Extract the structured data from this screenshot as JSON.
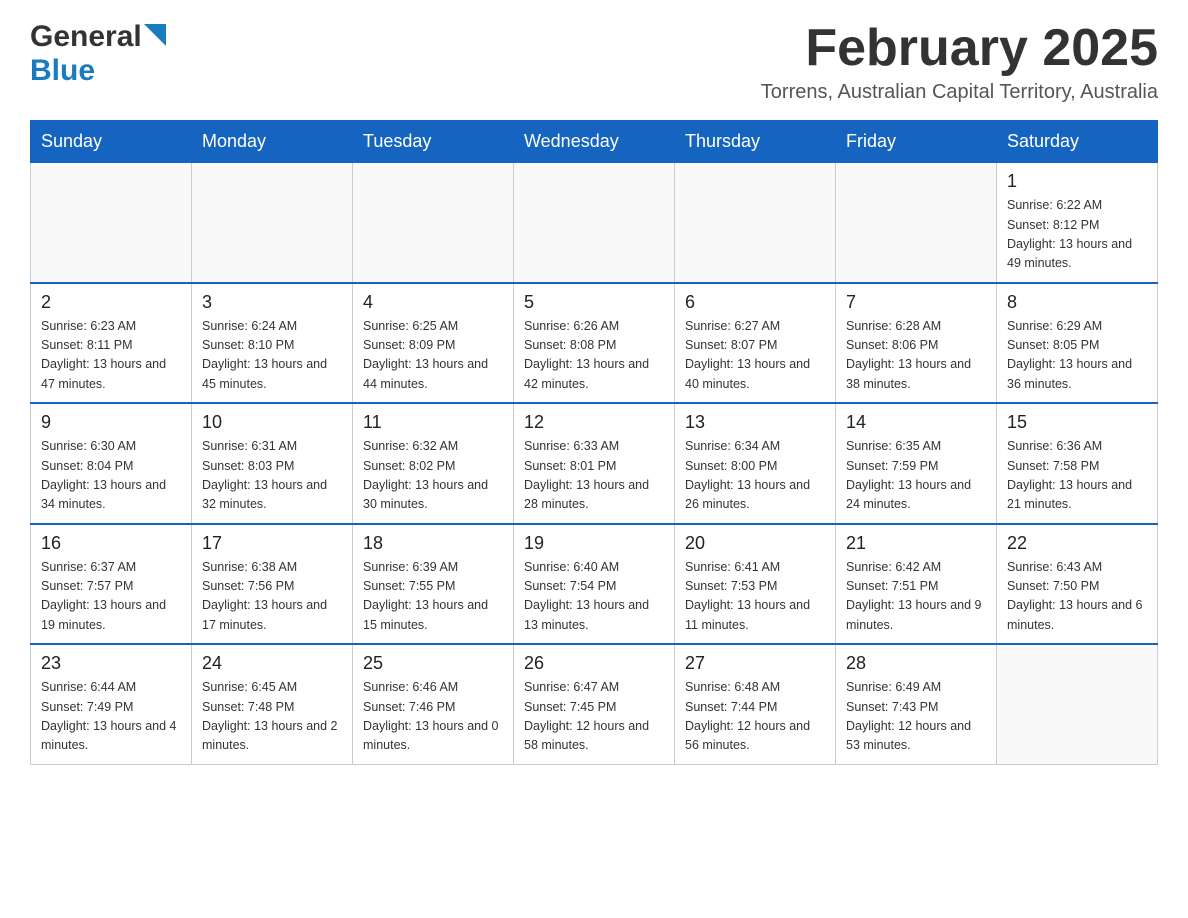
{
  "header": {
    "logo_general": "General",
    "logo_blue": "Blue",
    "title": "February 2025",
    "location": "Torrens, Australian Capital Territory, Australia"
  },
  "days_of_week": [
    "Sunday",
    "Monday",
    "Tuesday",
    "Wednesday",
    "Thursday",
    "Friday",
    "Saturday"
  ],
  "weeks": [
    [
      {
        "day": "",
        "sunrise": "",
        "sunset": "",
        "daylight": "",
        "empty": true
      },
      {
        "day": "",
        "sunrise": "",
        "sunset": "",
        "daylight": "",
        "empty": true
      },
      {
        "day": "",
        "sunrise": "",
        "sunset": "",
        "daylight": "",
        "empty": true
      },
      {
        "day": "",
        "sunrise": "",
        "sunset": "",
        "daylight": "",
        "empty": true
      },
      {
        "day": "",
        "sunrise": "",
        "sunset": "",
        "daylight": "",
        "empty": true
      },
      {
        "day": "",
        "sunrise": "",
        "sunset": "",
        "daylight": "",
        "empty": true
      },
      {
        "day": "1",
        "sunrise": "Sunrise: 6:22 AM",
        "sunset": "Sunset: 8:12 PM",
        "daylight": "Daylight: 13 hours and 49 minutes.",
        "empty": false
      }
    ],
    [
      {
        "day": "2",
        "sunrise": "Sunrise: 6:23 AM",
        "sunset": "Sunset: 8:11 PM",
        "daylight": "Daylight: 13 hours and 47 minutes.",
        "empty": false
      },
      {
        "day": "3",
        "sunrise": "Sunrise: 6:24 AM",
        "sunset": "Sunset: 8:10 PM",
        "daylight": "Daylight: 13 hours and 45 minutes.",
        "empty": false
      },
      {
        "day": "4",
        "sunrise": "Sunrise: 6:25 AM",
        "sunset": "Sunset: 8:09 PM",
        "daylight": "Daylight: 13 hours and 44 minutes.",
        "empty": false
      },
      {
        "day": "5",
        "sunrise": "Sunrise: 6:26 AM",
        "sunset": "Sunset: 8:08 PM",
        "daylight": "Daylight: 13 hours and 42 minutes.",
        "empty": false
      },
      {
        "day": "6",
        "sunrise": "Sunrise: 6:27 AM",
        "sunset": "Sunset: 8:07 PM",
        "daylight": "Daylight: 13 hours and 40 minutes.",
        "empty": false
      },
      {
        "day": "7",
        "sunrise": "Sunrise: 6:28 AM",
        "sunset": "Sunset: 8:06 PM",
        "daylight": "Daylight: 13 hours and 38 minutes.",
        "empty": false
      },
      {
        "day": "8",
        "sunrise": "Sunrise: 6:29 AM",
        "sunset": "Sunset: 8:05 PM",
        "daylight": "Daylight: 13 hours and 36 minutes.",
        "empty": false
      }
    ],
    [
      {
        "day": "9",
        "sunrise": "Sunrise: 6:30 AM",
        "sunset": "Sunset: 8:04 PM",
        "daylight": "Daylight: 13 hours and 34 minutes.",
        "empty": false
      },
      {
        "day": "10",
        "sunrise": "Sunrise: 6:31 AM",
        "sunset": "Sunset: 8:03 PM",
        "daylight": "Daylight: 13 hours and 32 minutes.",
        "empty": false
      },
      {
        "day": "11",
        "sunrise": "Sunrise: 6:32 AM",
        "sunset": "Sunset: 8:02 PM",
        "daylight": "Daylight: 13 hours and 30 minutes.",
        "empty": false
      },
      {
        "day": "12",
        "sunrise": "Sunrise: 6:33 AM",
        "sunset": "Sunset: 8:01 PM",
        "daylight": "Daylight: 13 hours and 28 minutes.",
        "empty": false
      },
      {
        "day": "13",
        "sunrise": "Sunrise: 6:34 AM",
        "sunset": "Sunset: 8:00 PM",
        "daylight": "Daylight: 13 hours and 26 minutes.",
        "empty": false
      },
      {
        "day": "14",
        "sunrise": "Sunrise: 6:35 AM",
        "sunset": "Sunset: 7:59 PM",
        "daylight": "Daylight: 13 hours and 24 minutes.",
        "empty": false
      },
      {
        "day": "15",
        "sunrise": "Sunrise: 6:36 AM",
        "sunset": "Sunset: 7:58 PM",
        "daylight": "Daylight: 13 hours and 21 minutes.",
        "empty": false
      }
    ],
    [
      {
        "day": "16",
        "sunrise": "Sunrise: 6:37 AM",
        "sunset": "Sunset: 7:57 PM",
        "daylight": "Daylight: 13 hours and 19 minutes.",
        "empty": false
      },
      {
        "day": "17",
        "sunrise": "Sunrise: 6:38 AM",
        "sunset": "Sunset: 7:56 PM",
        "daylight": "Daylight: 13 hours and 17 minutes.",
        "empty": false
      },
      {
        "day": "18",
        "sunrise": "Sunrise: 6:39 AM",
        "sunset": "Sunset: 7:55 PM",
        "daylight": "Daylight: 13 hours and 15 minutes.",
        "empty": false
      },
      {
        "day": "19",
        "sunrise": "Sunrise: 6:40 AM",
        "sunset": "Sunset: 7:54 PM",
        "daylight": "Daylight: 13 hours and 13 minutes.",
        "empty": false
      },
      {
        "day": "20",
        "sunrise": "Sunrise: 6:41 AM",
        "sunset": "Sunset: 7:53 PM",
        "daylight": "Daylight: 13 hours and 11 minutes.",
        "empty": false
      },
      {
        "day": "21",
        "sunrise": "Sunrise: 6:42 AM",
        "sunset": "Sunset: 7:51 PM",
        "daylight": "Daylight: 13 hours and 9 minutes.",
        "empty": false
      },
      {
        "day": "22",
        "sunrise": "Sunrise: 6:43 AM",
        "sunset": "Sunset: 7:50 PM",
        "daylight": "Daylight: 13 hours and 6 minutes.",
        "empty": false
      }
    ],
    [
      {
        "day": "23",
        "sunrise": "Sunrise: 6:44 AM",
        "sunset": "Sunset: 7:49 PM",
        "daylight": "Daylight: 13 hours and 4 minutes.",
        "empty": false
      },
      {
        "day": "24",
        "sunrise": "Sunrise: 6:45 AM",
        "sunset": "Sunset: 7:48 PM",
        "daylight": "Daylight: 13 hours and 2 minutes.",
        "empty": false
      },
      {
        "day": "25",
        "sunrise": "Sunrise: 6:46 AM",
        "sunset": "Sunset: 7:46 PM",
        "daylight": "Daylight: 13 hours and 0 minutes.",
        "empty": false
      },
      {
        "day": "26",
        "sunrise": "Sunrise: 6:47 AM",
        "sunset": "Sunset: 7:45 PM",
        "daylight": "Daylight: 12 hours and 58 minutes.",
        "empty": false
      },
      {
        "day": "27",
        "sunrise": "Sunrise: 6:48 AM",
        "sunset": "Sunset: 7:44 PM",
        "daylight": "Daylight: 12 hours and 56 minutes.",
        "empty": false
      },
      {
        "day": "28",
        "sunrise": "Sunrise: 6:49 AM",
        "sunset": "Sunset: 7:43 PM",
        "daylight": "Daylight: 12 hours and 53 minutes.",
        "empty": false
      },
      {
        "day": "",
        "sunrise": "",
        "sunset": "",
        "daylight": "",
        "empty": true
      }
    ]
  ]
}
